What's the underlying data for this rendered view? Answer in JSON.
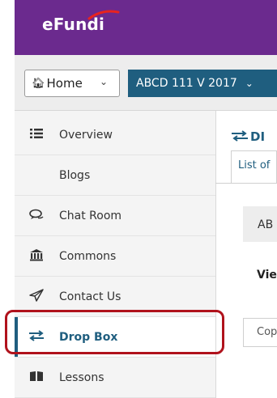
{
  "header": {
    "logo_text": "eFundi",
    "brand_color": "#6b2a8e"
  },
  "site_nav": {
    "home_label": "Home",
    "site_label": "ABCD 111 V 2017",
    "site_color": "#1f5e7f"
  },
  "sidebar": {
    "items": [
      {
        "label": "Overview",
        "icon": "list-icon"
      },
      {
        "label": "Blogs",
        "icon": ""
      },
      {
        "label": "Chat Room",
        "icon": "chat-icon"
      },
      {
        "label": "Commons",
        "icon": "bank-icon"
      },
      {
        "label": "Contact Us",
        "icon": "paper-plane-icon"
      },
      {
        "label": "Drop Box",
        "icon": "exchange-icon",
        "active": true
      },
      {
        "label": "Lessons",
        "icon": "book-icon"
      }
    ]
  },
  "content": {
    "title": "DI",
    "tab_label": "List of",
    "box_text": "AB",
    "view_text": "Vie",
    "copy_button": "Cop"
  },
  "annotation": {
    "highlight_color": "#b0121c"
  }
}
